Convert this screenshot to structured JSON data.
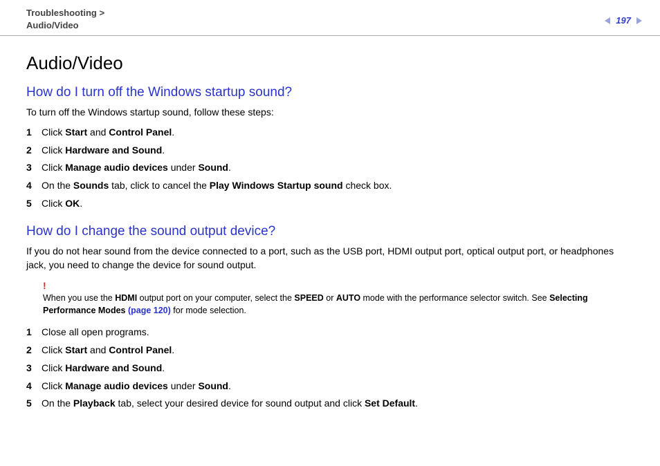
{
  "header": {
    "breadcrumb1": "Troubleshooting",
    "separator": ">",
    "breadcrumb2": "Audio/Video",
    "page_number": "197"
  },
  "main": {
    "title": "Audio/Video",
    "section1": {
      "heading": "How do I turn off the Windows startup sound?",
      "intro": "To turn off the Windows startup sound, follow these steps:",
      "steps": [
        {
          "num": "1",
          "pre": "Click ",
          "b1": "Start",
          "mid": " and ",
          "b2": "Control Panel",
          "post": "."
        },
        {
          "num": "2",
          "pre": "Click ",
          "b1": "Hardware and Sound",
          "post": "."
        },
        {
          "num": "3",
          "pre": "Click ",
          "b1": "Manage audio devices",
          "mid": " under ",
          "b2": "Sound",
          "post": "."
        },
        {
          "num": "4",
          "pre": "On the ",
          "b1": "Sounds",
          "mid": " tab, click to cancel the ",
          "b2": "Play Windows Startup sound",
          "post": " check box."
        },
        {
          "num": "5",
          "pre": "Click ",
          "b1": "OK",
          "post": "."
        }
      ]
    },
    "section2": {
      "heading": "How do I change the sound output device?",
      "intro": "If you do not hear sound from the device connected to a port, such as the USB port, HDMI output port, optical output port, or headphones jack, you need to change the device for sound output.",
      "note": {
        "bang": "!",
        "t1": "When you use the ",
        "b1": "HDMI",
        "t2": " output port on your computer, select the ",
        "b2": "SPEED",
        "t3": " or ",
        "b3": "AUTO",
        "t4": " mode with the performance selector switch. See ",
        "b4": "Selecting Performance Modes ",
        "link": "(page 120)",
        "t5": " for mode selection."
      },
      "steps": [
        {
          "num": "1",
          "pre": "Close all open programs."
        },
        {
          "num": "2",
          "pre": "Click ",
          "b1": "Start",
          "mid": " and ",
          "b2": "Control Panel",
          "post": "."
        },
        {
          "num": "3",
          "pre": "Click ",
          "b1": "Hardware and Sound",
          "post": "."
        },
        {
          "num": "4",
          "pre": "Click ",
          "b1": "Manage audio devices",
          "mid": " under ",
          "b2": "Sound",
          "post": "."
        },
        {
          "num": "5",
          "pre": "On the ",
          "b1": "Playback",
          "mid": " tab, select your desired device for sound output and click ",
          "b2": "Set Default",
          "post": "."
        }
      ]
    }
  }
}
